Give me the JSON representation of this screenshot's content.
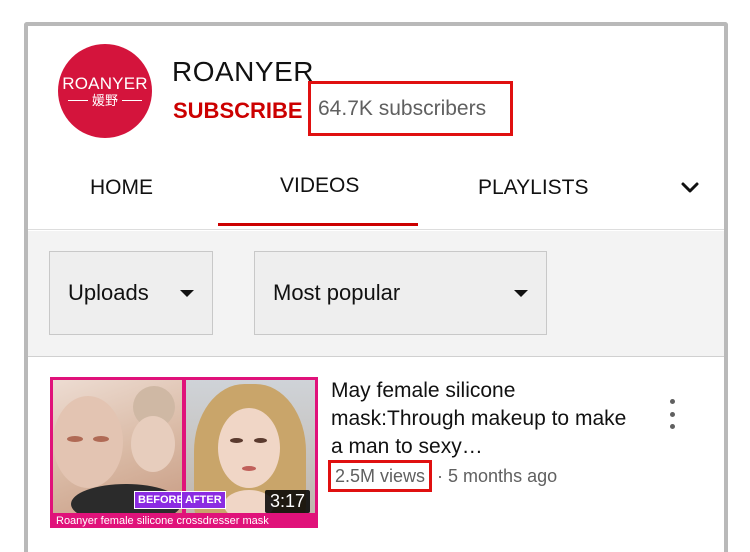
{
  "channel": {
    "avatar_brand": "ROANYER",
    "avatar_cjk": "媛野",
    "name": "ROANYER",
    "subscribe_label": "SUBSCRIBE",
    "subscriber_count": "64.7K subscribers",
    "avatar_color": "#d4143c"
  },
  "tabs": [
    {
      "label": "HOME",
      "selected": false
    },
    {
      "label": "VIDEOS",
      "selected": true
    },
    {
      "label": "PLAYLISTS",
      "selected": false
    }
  ],
  "tabs_more_icon": "chevron-down-icon",
  "filters": {
    "uploads": "Uploads",
    "sort": "Most popular"
  },
  "video": {
    "title": "May female silicone mask:Through makeup to make a man to sexy…",
    "views": "2.5M views",
    "separator": "·",
    "age": "5 months ago",
    "duration": "3:17",
    "thumb_label_before": "BEFORE",
    "thumb_label_after": "AFTER",
    "thumb_caption": "Roanyer female silicone crossdresser mask"
  },
  "colors": {
    "accent": "#cc0000",
    "highlight_box": "#e01010",
    "thumb_frame": "#e0127a"
  }
}
